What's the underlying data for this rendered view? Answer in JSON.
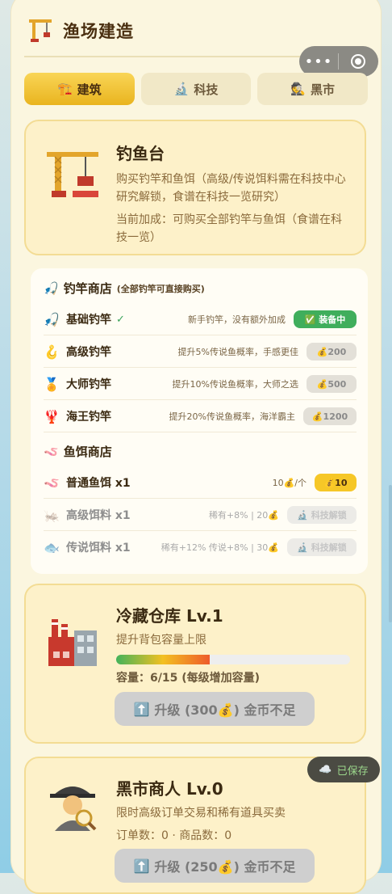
{
  "header": {
    "title": "渔场建造",
    "icon": "construction-crane-icon"
  },
  "capsule": {
    "more_glyph": "•••",
    "close_icon": "target-icon"
  },
  "tabs": [
    {
      "label": "建筑",
      "icon": "crane-icon",
      "active": true
    },
    {
      "label": "科技",
      "icon": "microscope-icon",
      "active": false
    },
    {
      "label": "黑市",
      "icon": "spy-icon",
      "active": false
    }
  ],
  "fishing_platform": {
    "title": "钓鱼台",
    "desc": "购买钓竿和鱼饵（高级/传说饵料需在科技中心研究解锁，食谱在科技一览研究）",
    "current": "当前加成：可购买全部钓竿与鱼饵（食谱在科技一览）"
  },
  "rod_shop": {
    "title": "钓竿商店",
    "note": "(全部钓竿可直接购买)",
    "items": [
      {
        "name": "基础钓竿",
        "desc": "新手钓竿，没有额外加成",
        "button": "✅ 装备中",
        "check": "✓"
      },
      {
        "name": "高级钓竿",
        "desc": "提升5%传说鱼概率，手感更佳",
        "button": "💰200"
      },
      {
        "name": "大师钓竿",
        "desc": "提升10%传说鱼概率，大师之选",
        "button": "💰500"
      },
      {
        "name": "海王钓竿",
        "desc": "提升20%传说鱼概率，海洋霸主",
        "button": "💰1200"
      }
    ]
  },
  "bait_shop": {
    "title": "鱼饵商店",
    "items": [
      {
        "name": "普通鱼饵 x1",
        "desc": "10💰/个",
        "button": "💰10"
      },
      {
        "name": "高级饵料 x1",
        "desc": "稀有+8% | 20💰",
        "button": "🔬 科技解锁"
      },
      {
        "name": "传说饵料 x1",
        "desc": "稀有+12% 传说+8% | 30💰",
        "button": "🔬 科技解锁"
      }
    ]
  },
  "cold_storage": {
    "title": "冷藏仓库 Lv.1",
    "desc": "提升背包容量上限",
    "capacity_fraction": 0.4,
    "capacity": "容量：6/15 (每级增加容量)",
    "upgrade": "升级 (300💰) 金币不足"
  },
  "black_market": {
    "title": "黑市商人 Lv.0",
    "desc": "限时高级订单交易和稀有道具买卖",
    "stats": "订单数：0 · 商品数：0",
    "upgrade": "升级 (250💰) 金币不足"
  },
  "saved": {
    "label": "已保存"
  }
}
